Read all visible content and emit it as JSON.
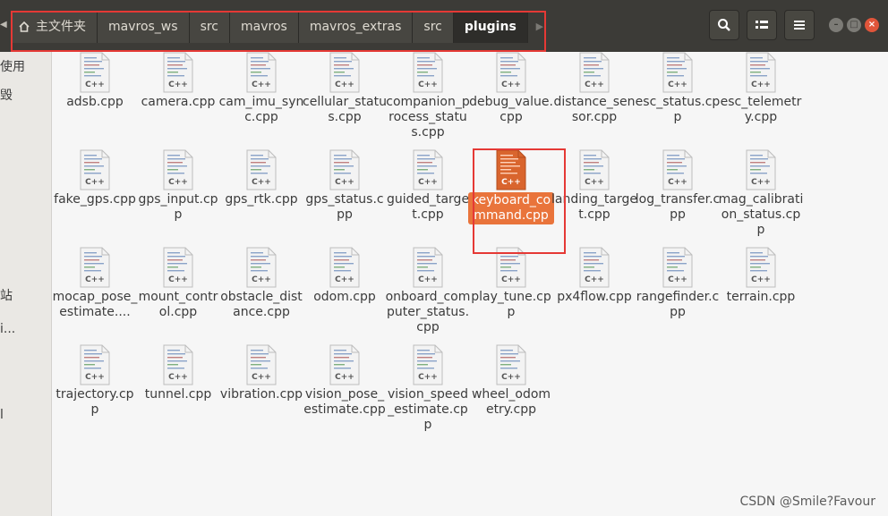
{
  "breadcrumbs": [
    "主文件夹",
    "mavros_ws",
    "src",
    "mavros",
    "mavros_extras",
    "src",
    "plugins"
  ],
  "sidebar_fragments": [
    "使用",
    "毁",
    "站",
    "i...",
    "l"
  ],
  "files": [
    {
      "name": "adsb.cpp"
    },
    {
      "name": "camera.cpp"
    },
    {
      "name": "cam_imu_sync.cpp"
    },
    {
      "name": "cellular_status.cpp"
    },
    {
      "name": "companion_process_status.cpp"
    },
    {
      "name": "debug_value.cpp"
    },
    {
      "name": "distance_sensor.cpp"
    },
    {
      "name": "esc_status.cpp"
    },
    {
      "name": "esc_telemetry.cpp"
    },
    {
      "name": "fake_gps.cpp"
    },
    {
      "name": "gps_input.cpp"
    },
    {
      "name": "gps_rtk.cpp"
    },
    {
      "name": "gps_status.cpp"
    },
    {
      "name": "guided_target.cpp"
    },
    {
      "name": "keyboard_command.cpp"
    },
    {
      "name": "landing_target.cpp"
    },
    {
      "name": "log_transfer.cpp"
    },
    {
      "name": "mag_calibration_status.cpp"
    },
    {
      "name": "mocap_pose_estimate...."
    },
    {
      "name": "mount_control.cpp"
    },
    {
      "name": "obstacle_distance.cpp"
    },
    {
      "name": "odom.cpp"
    },
    {
      "name": "onboard_computer_status.cpp"
    },
    {
      "name": "play_tune.cpp"
    },
    {
      "name": "px4flow.cpp"
    },
    {
      "name": "rangefinder.cpp"
    },
    {
      "name": "terrain.cpp"
    },
    {
      "name": "trajectory.cpp"
    },
    {
      "name": "tunnel.cpp"
    },
    {
      "name": "vibration.cpp"
    },
    {
      "name": "vision_pose_estimate.cpp"
    },
    {
      "name": "vision_speed_estimate.cpp"
    },
    {
      "name": "wheel_odometry.cpp"
    }
  ],
  "selected_file": "keyboard_command.cpp",
  "file_icon_label": "C++",
  "watermark": "CSDN @Smile?Favour",
  "colors": {
    "selection": "#e9743b",
    "highlight_box": "#e53935",
    "header": "#3c3b37"
  }
}
